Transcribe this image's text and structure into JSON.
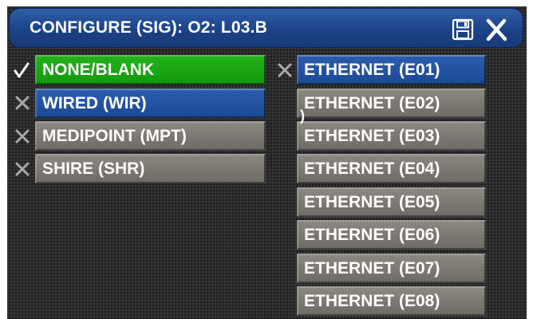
{
  "title": "CONFIGURE (SIG): O2: L03.B",
  "icons": {
    "save": "save-icon",
    "close": "close-icon",
    "selected": "checkmark-icon",
    "unselected": "x-mark-icon"
  },
  "left_options": [
    {
      "label": "NONE/BLANK",
      "state": "checked"
    },
    {
      "label": "WIRED (WIR)",
      "state": "x"
    },
    {
      "label": "MEDIPOINT (MPT)",
      "state": "x"
    },
    {
      "label": "SHIRE (SHR)",
      "state": "x"
    }
  ],
  "right_options": [
    {
      "label": "ETHERNET (E01)",
      "state": "x"
    },
    {
      "label": "ETHERNET (E02)"
    },
    {
      "label": "ETHERNET (E03)"
    },
    {
      "label": "ETHERNET (E04)"
    },
    {
      "label": "ETHERNET (E05)"
    },
    {
      "label": "ETHERNET (E06)"
    },
    {
      "label": "ETHERNET (E07)"
    },
    {
      "label": "ETHERNET (E08)"
    }
  ],
  "stray_glyph": ")",
  "colors": {
    "title_bar": "#1b4388",
    "selected_green": "#129a0d",
    "highlight_blue": "#1c4a96",
    "option_gray": "#7a7671",
    "background": "#2b2b2b"
  }
}
